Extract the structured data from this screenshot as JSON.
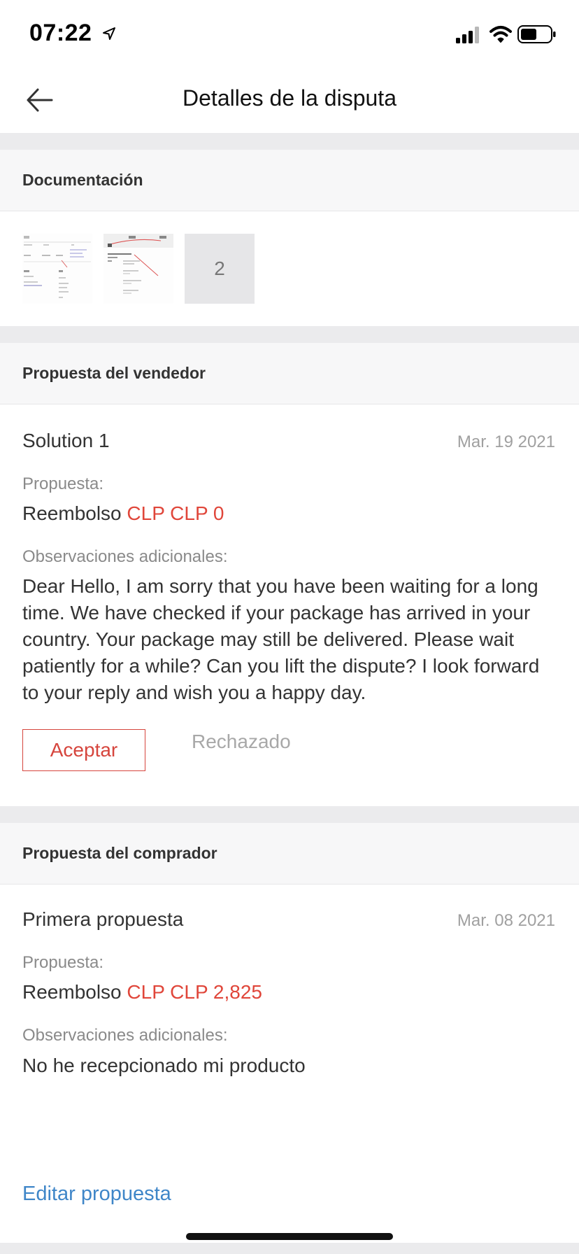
{
  "status_bar": {
    "time": "07:22"
  },
  "header": {
    "title": "Detalles de la disputa"
  },
  "documentation": {
    "title": "Documentación",
    "more_count": "2"
  },
  "seller_proposal": {
    "title": "Propuesta del vendedor",
    "solution_title": "Solution 1",
    "date": "Mar. 19 2021",
    "proposal_label": "Propuesta:",
    "refund_label": "Reembolso",
    "refund_amount": "CLP CLP 0",
    "notes_label": "Observaciones adicionales:",
    "notes": "Dear Hello, I am sorry that you have been waiting for a long time. We have checked if your package has arrived in your country. Your package may still be delivered. Please wait patiently for a while? Can you lift the dispute? I look forward to your reply and wish you a happy day.",
    "accept_label": "Aceptar",
    "reject_label": "Rechazado"
  },
  "buyer_proposal": {
    "title": "Propuesta del comprador",
    "solution_title": "Primera propuesta",
    "date": "Mar. 08 2021",
    "proposal_label": "Propuesta:",
    "refund_label": "Reembolso",
    "refund_amount": "CLP CLP 2,825",
    "notes_label": "Observaciones adicionales:",
    "notes": "No he recepcionado mi producto",
    "edit_label": "Editar propuesta"
  },
  "colors": {
    "accent_red": "#e0463a",
    "link_blue": "#3f86c8",
    "muted_gray": "#a0a0a0",
    "section_gap": "#ebebed"
  }
}
